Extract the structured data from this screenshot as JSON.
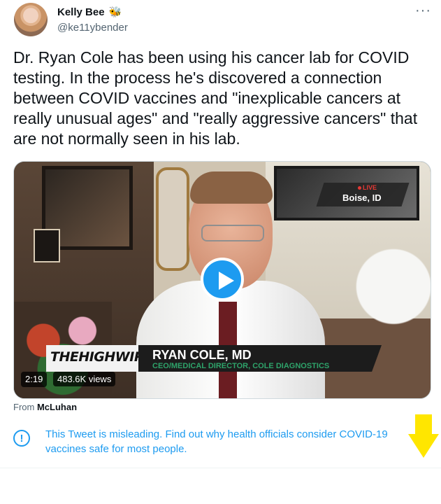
{
  "author": {
    "name": "Kelly Bee",
    "badge_icon": "bee-icon",
    "handle": "@ke11ybender"
  },
  "tweet": {
    "text": "Dr. Ryan Cole has been using his cancer lab for COVID testing. In the process he's discovered a connection between COVID vaccines and \"inexplicable cancers at really unusual ages\" and \"really aggressive cancers\" that are not normally seen in his lab."
  },
  "video": {
    "live_label": "LIVE",
    "location": "Boise, ID",
    "brand": "THEHIGHWIRE",
    "guest_name": "RYAN COLE, MD",
    "guest_title": "CEO/MEDICAL DIRECTOR, COLE DIAGNOSTICS",
    "duration": "2:19",
    "views": "483.6K views"
  },
  "source": {
    "prefix": "From",
    "name": "McLuhan"
  },
  "notice": {
    "icon": "exclamation-icon",
    "text": "This Tweet is misleading. Find out why health officials consider COVID-19 vaccines safe for most people."
  },
  "colors": {
    "accent": "#1d9bf0",
    "annotation_arrow": "#ffe600"
  }
}
